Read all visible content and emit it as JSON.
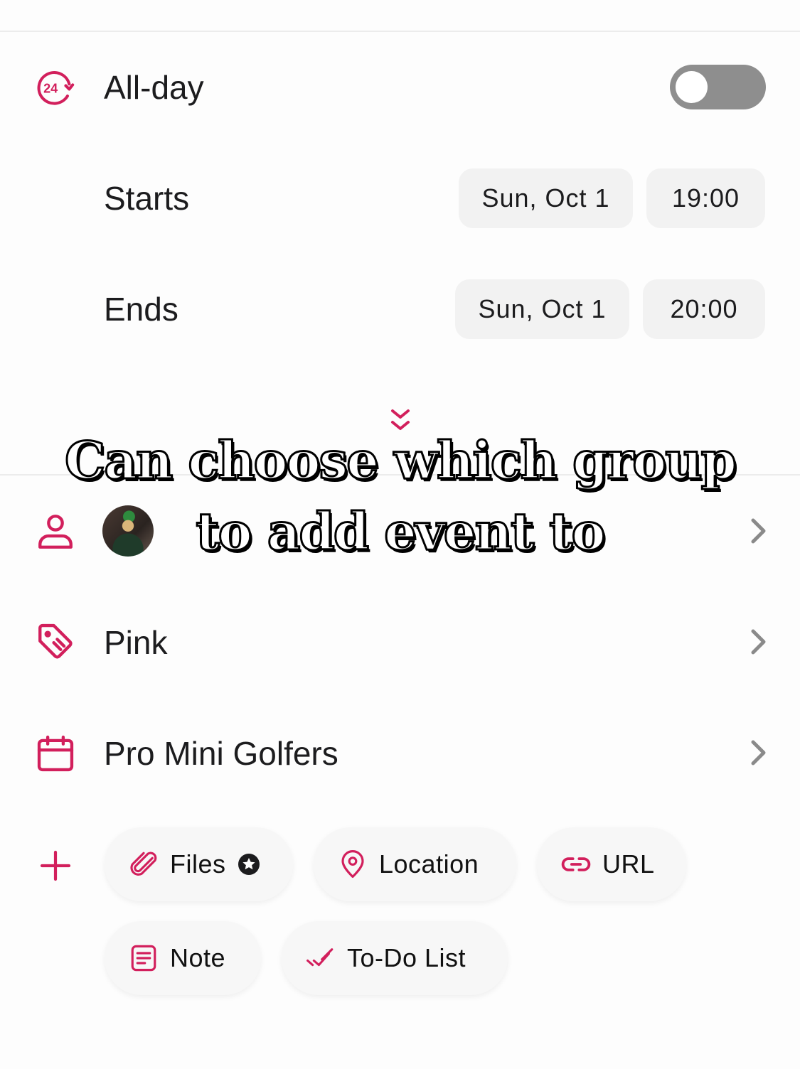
{
  "theme": {
    "accent": "#d21f5c",
    "toggle_off": "#8e8e8e",
    "pill_bg": "#f2f2f2",
    "chevron": "#8a8a8a"
  },
  "all_day": {
    "label": "All-day",
    "icon": "24-hour-icon",
    "enabled": false
  },
  "starts": {
    "label": "Starts",
    "date": "Sun, Oct 1",
    "time": "19:00"
  },
  "ends": {
    "label": "Ends",
    "date": "Sun, Oct 1",
    "time": "20:00"
  },
  "expand": {
    "icon": "double-chevron-down-icon"
  },
  "caption": {
    "line1": "Can choose which group",
    "line2": "to add event to"
  },
  "attendee": {
    "icon": "person-icon",
    "avatar": "user-avatar"
  },
  "tag": {
    "icon": "tag-icon",
    "label": "Pink"
  },
  "calendar": {
    "icon": "calendar-icon",
    "label": "Pro Mini Golfers"
  },
  "add_icon": "plus-icon",
  "chips": [
    {
      "label": "Files",
      "icon": "paperclip-icon",
      "badge": "premium-star-icon"
    },
    {
      "label": "Location",
      "icon": "location-pin-icon"
    },
    {
      "label": "URL",
      "icon": "link-icon"
    },
    {
      "label": "Note",
      "icon": "note-icon"
    },
    {
      "label": "To-Do List",
      "icon": "double-check-icon"
    }
  ]
}
